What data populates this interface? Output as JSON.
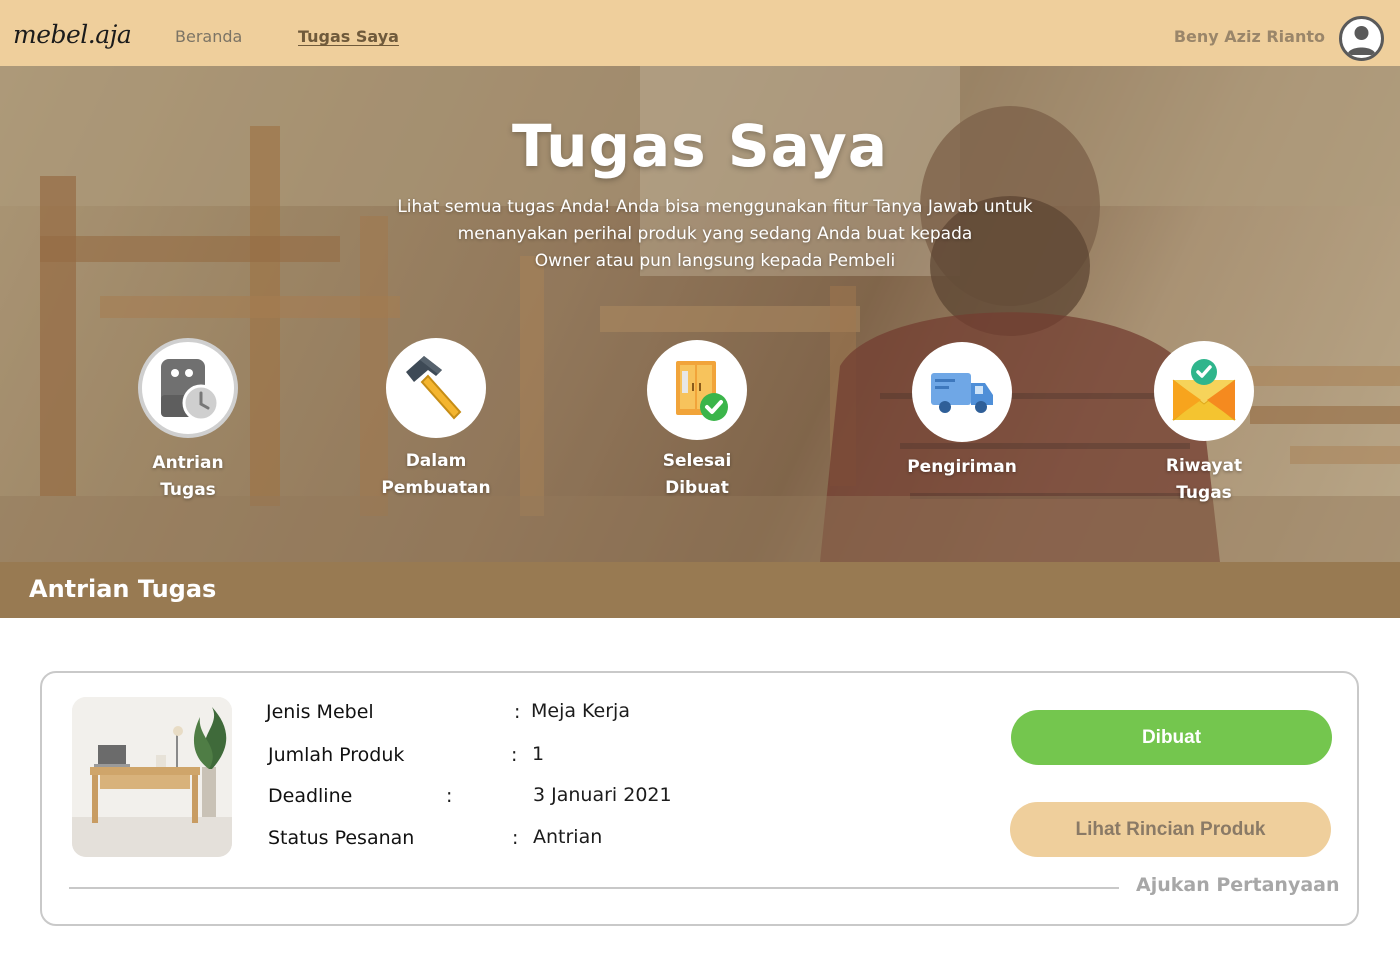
{
  "nav": {
    "logo": "mebel.aja",
    "links": [
      {
        "label": "Beranda",
        "active": false
      },
      {
        "label": "Tugas Saya",
        "active": true
      }
    ],
    "user_name": "Beny Aziz Rianto",
    "accent_color": "#efcf9c"
  },
  "hero": {
    "title": "Tugas Saya",
    "subtitle_lines": [
      "Lihat semua tugas Anda! Anda bisa menggunakan fitur Tanya Jawab untuk",
      "menanyakan perihal produk yang sedang Anda buat kepada",
      "Owner atau pun langsung kepada Pembeli"
    ],
    "categories": [
      {
        "line1": "Antrian",
        "line2": "Tugas",
        "icon": "queue-clock-icon"
      },
      {
        "line1": "Dalam",
        "line2": "Pembuatan",
        "icon": "hammer-icon"
      },
      {
        "line1": "Selesai",
        "line2": "Dibuat",
        "icon": "wardrobe-check-icon"
      },
      {
        "line1": "Pengiriman",
        "line2": "",
        "icon": "truck-icon"
      },
      {
        "line1": "Riwayat",
        "line2": "Tugas",
        "icon": "envelope-check-icon"
      }
    ]
  },
  "section": {
    "title": "Antrian Tugas",
    "bar_color": "#987a52"
  },
  "task": {
    "fields": [
      {
        "label": "Jenis Mebel",
        "value": "Meja Kerja"
      },
      {
        "label": "Jumlah Produk",
        "value": "1"
      },
      {
        "label": "Deadline",
        "value": "3 Januari 2021"
      },
      {
        "label": "Status Pesanan",
        "value": "Antrian"
      }
    ],
    "separator": ":",
    "status_button": "Dibuat",
    "status_color": "#74c64e",
    "detail_button": "Lihat Rincian Produk",
    "ask_link": "Ajukan Pertanyaan"
  }
}
